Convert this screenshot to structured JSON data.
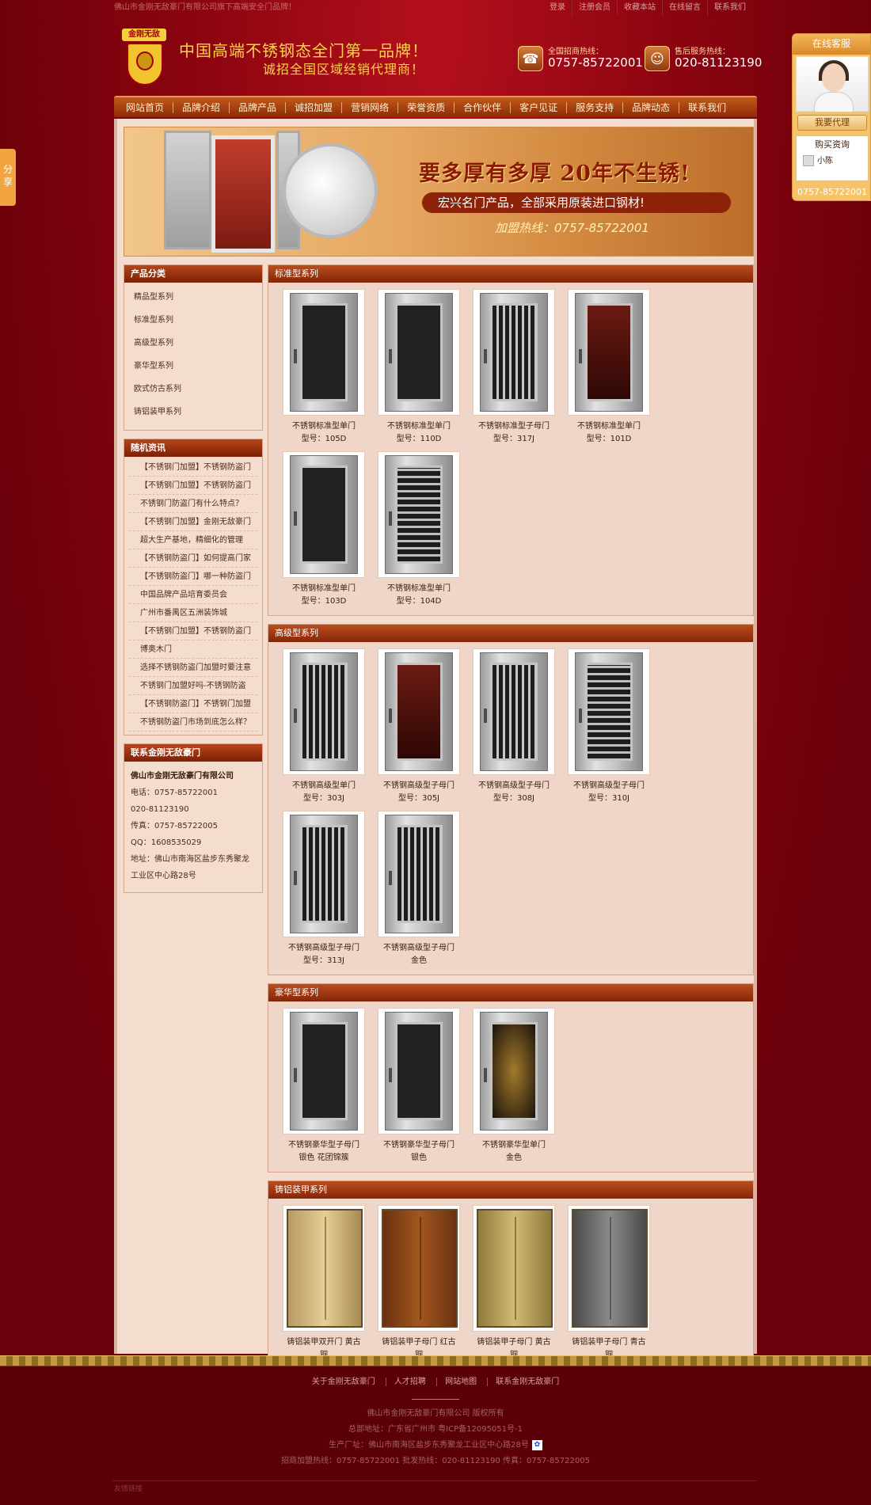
{
  "topbar": {
    "tagline": "佛山市金刚无敌豪门有限公司旗下高端安全门品牌！",
    "links": [
      "登录",
      "注册会员",
      "收藏本站",
      "在线留言",
      "联系我们"
    ]
  },
  "header": {
    "logo_text": "金刚无敌",
    "slogan1": "中国高端不锈钢态全门第一品牌！",
    "slogan2": "诚招全国区域经销代理商！",
    "hotline1_label": "全国招商热线：",
    "hotline1_number": "0757-85722001",
    "hotline2_label": "售后服务热线：",
    "hotline2_number": "020-81123190"
  },
  "nav": [
    "网站首页",
    "品牌介绍",
    "品牌产品",
    "诚招加盟",
    "营销网络",
    "荣誉资质",
    "合作伙伴",
    "客户见证",
    "服务支持",
    "品牌动态",
    "联系我们"
  ],
  "banner": {
    "headline": "要多厚有多厚 20年不生锈!",
    "subline": "宏兴名门产品，全部采用原装进口钢材!",
    "hotline": "加盟热线：0757-85722001"
  },
  "left": {
    "categories_title": "产品分类",
    "categories": [
      "精品型系列",
      "标准型系列",
      "高级型系列",
      "豪华型系列",
      "欧式仿古系列",
      "铸铝装甲系列"
    ],
    "news_title": "随机资讯",
    "news": [
      "【不锈钢门加盟】不锈钢防盗门",
      "【不锈钢门加盟】不锈钢防盗门",
      "不锈钢门防盗门有什么特点？",
      "【不锈钢门加盟】金刚无敌豪门",
      "超大生产基地，精细化的管理",
      "【不锈钢防盗门】如何提高门家",
      "【不锈钢防盗门】哪一种防盗门",
      "中国品牌产品培育委员会",
      "广州市番禺区五洲装饰城",
      "【不锈钢门加盟】不锈钢防盗门",
      "博奥木门",
      "选择不锈钢防盗门加盟时要注意",
      "不锈钢门加盟好吗-不锈钢防盗",
      "【不锈钢防盗门】不锈钢门加盟",
      "不锈钢防盗门市场到底怎么样？"
    ],
    "contact_title": "联系金刚无敌豪门",
    "company": "佛山市金刚无敌豪门有限公司",
    "contact_lines": [
      "电话：0757-85722001",
      "020-81123190",
      "传真：0757-85722005",
      "QQ：1608535029",
      "地址：佛山市南海区盐步东秀聚龙",
      "工业区中心路28号"
    ]
  },
  "sections": [
    {
      "title": "标准型系列",
      "items": [
        {
          "name": "不锈钢标准型单门",
          "model": "型号：105D",
          "style": "ss"
        },
        {
          "name": "不锈钢标准型单门",
          "model": "型号：110D",
          "style": "ss"
        },
        {
          "name": "不锈钢标准型子母门",
          "model": "型号：317J",
          "style": "bars"
        },
        {
          "name": "不锈钢标准型单门",
          "model": "型号：101D",
          "style": "red"
        },
        {
          "name": "不锈钢标准型单门",
          "model": "型号：103D",
          "style": "ss"
        },
        {
          "name": "不锈钢标准型单门",
          "model": "型号：104D",
          "style": "hb"
        }
      ]
    },
    {
      "title": "高级型系列",
      "items": [
        {
          "name": "不锈钢高级型单门",
          "model": "型号：303J",
          "style": "bars"
        },
        {
          "name": "不锈钢高级型子母门",
          "model": "型号：305J",
          "style": "red"
        },
        {
          "name": "不锈钢高级型子母门",
          "model": "型号：308J",
          "style": "bars"
        },
        {
          "name": "不锈钢高级型子母门",
          "model": "型号：310J",
          "style": "hb"
        },
        {
          "name": "不锈钢高级型子母门",
          "model": "型号：313J",
          "style": "bars"
        },
        {
          "name": "不锈钢高级型子母门",
          "model": "金色",
          "style": "bars"
        }
      ]
    },
    {
      "title": "豪华型系列",
      "items": [
        {
          "name": "不锈钢豪华型子母门",
          "model": "银色 花团锦簇",
          "style": "ss"
        },
        {
          "name": "不锈钢豪华型子母门",
          "model": "银色",
          "style": "ss"
        },
        {
          "name": "不锈钢豪华型单门",
          "model": "金色",
          "style": "gold"
        }
      ]
    },
    {
      "title": "铸铝装甲系列",
      "items": [
        {
          "name": "铸铝装甲双开门 黄古",
          "model": "铜",
          "style": "brass"
        },
        {
          "name": "铸铝装甲子母门 红古",
          "model": "铜",
          "style": "bronze"
        },
        {
          "name": "铸铝装甲子母门 黄古",
          "model": "铜",
          "style": "goldcast"
        },
        {
          "name": "铸铝装甲子母门 青古",
          "model": "铜",
          "style": "grey"
        }
      ]
    }
  ],
  "sidepanel": {
    "title": "在线客服",
    "agent_button": "我要代理",
    "buy_title": "购买资询",
    "user": "小陈",
    "tel": "0757-85722001"
  },
  "share": "分享",
  "footer": {
    "links": [
      "关于金刚无敌豪门",
      "人才招聘",
      "网站地图",
      "联系金刚无敌豪门"
    ],
    "copyright": "佛山市金刚无敌豪门有限公司 版权所有",
    "office": "总部地址：广东省广州市 粤ICP备12095051号-1",
    "factory": "生产厂址：佛山市南海区盐步东秀聚龙工业区中心路28号",
    "phones": "招商加盟热线：0757-85722001 批发热线：020-81123190 传真：0757-85722005",
    "bottom": "友情链接"
  }
}
